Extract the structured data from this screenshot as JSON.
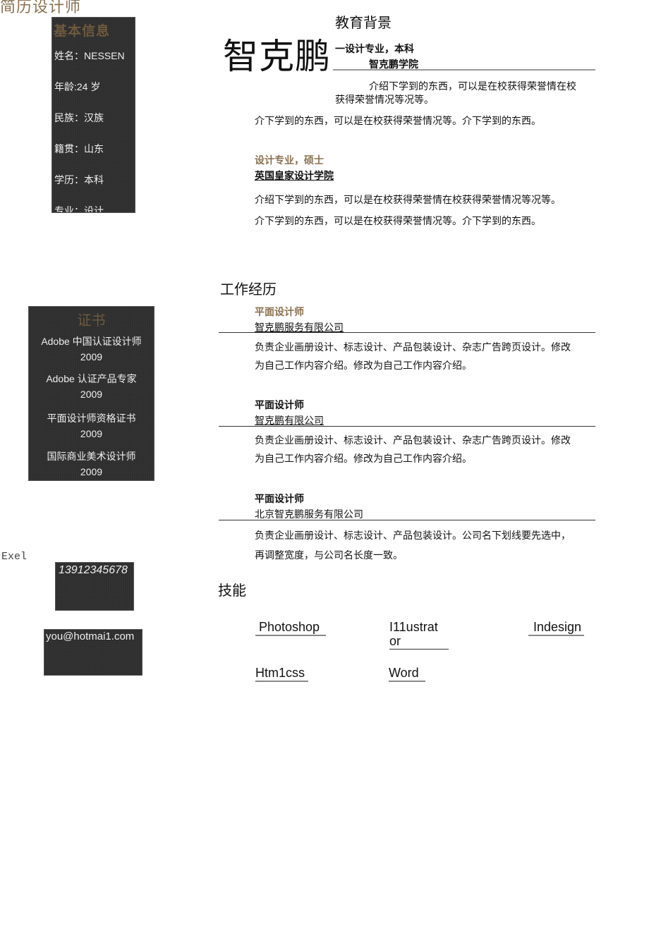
{
  "page_title": "简历设计师",
  "name": "智克鹏",
  "basic_info": {
    "heading": "基本信息",
    "rows": [
      "姓名：NESSEN",
      "年龄:24 岁",
      "民族：汉族",
      "籍贯：山东",
      "学历：本科",
      "专业：设计"
    ]
  },
  "certificates": {
    "heading": "证书",
    "items": [
      {
        "name": "Adobe 中国认证设计师",
        "year": "2009"
      },
      {
        "name": "Adobe 认证产品专家",
        "year": "2009"
      },
      {
        "name": "平面设计师资格证书",
        "year": "2009"
      },
      {
        "name": "国际商业美术设计师",
        "year": "2009"
      }
    ]
  },
  "contact": {
    "label": "Exel",
    "phone": "13912345678",
    "email": "you@hotmai1.com"
  },
  "education": {
    "heading": "教育背景",
    "entries": [
      {
        "degree": "一设计专业，本科",
        "school": "智克鹏学院",
        "desc_1a": "介绍下学到的东西，可以是在校获得荣誉情在校",
        "desc_1b": "获得荣誉情况等况等。",
        "desc_2": "介下学到的东西，可以是在校获得荣誉情况等。介下学到的东西。"
      },
      {
        "degree": "设计专业，硕士",
        "school": "英国皇家设计学院",
        "desc_1": "介绍下学到的东西，可以是在校获得荣誉情在校获得荣誉情况等况等。",
        "desc_2": "介下学到的东西，可以是在校获得荣誉情况等。介下学到的东西。"
      }
    ]
  },
  "work": {
    "heading": "工作经历",
    "entries": [
      {
        "title": "平面设计师",
        "company": "智克鹏服务有限公司",
        "desc_a": "负责企业画册设计、标志设计、产品包装设计、杂志广告跨页设计。修改",
        "desc_b": "为自己工作内容介绍。修改为自己工作内容介绍。"
      },
      {
        "title": "平面设计师",
        "company": "智克鹏有限公司",
        "desc_a": "负责企业画册设计、标志设计、产品包装设计、杂志广告跨页设计。修改",
        "desc_b": "为自己工作内容介绍。修改为自己工作内容介绍。"
      },
      {
        "title": "平面设计师",
        "company": "北京智克鹏服务有限公司",
        "desc_a": "负责企业画册设计、标志设计、产品包装设计。公司名下划线要先选中，",
        "desc_b": "再调整宽度，与公司名长度一致。"
      }
    ]
  },
  "skills": {
    "heading": "技能",
    "items": [
      "Photoshop",
      "I11ustrat\nor",
      "Indesign",
      "Htm1css",
      "Word"
    ]
  },
  "colors": {
    "accent_brown": "#8a7150",
    "dark_box": "#2f2f2f"
  }
}
